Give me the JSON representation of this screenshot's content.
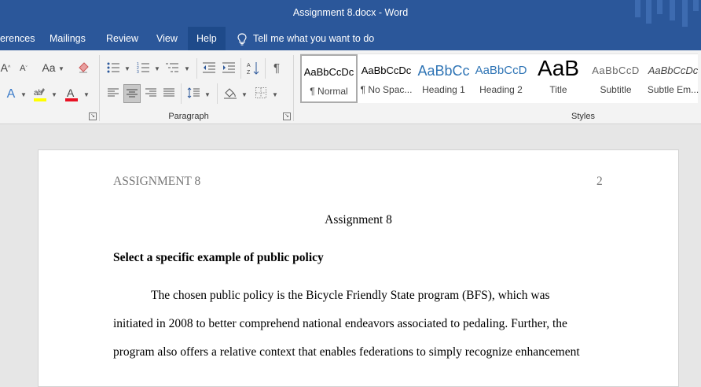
{
  "window": {
    "title": "Assignment 8.docx  -  Word"
  },
  "tabs": {
    "references": "erences",
    "mailings": "Mailings",
    "review": "Review",
    "view": "View",
    "help": "Help"
  },
  "tell_me": "Tell me what you want to do",
  "ribbon": {
    "font_size_label": "Aa",
    "groups": {
      "paragraph": "Paragraph",
      "styles": "Styles"
    },
    "styles": [
      {
        "sample": "AaBbCcDc",
        "name": "¶ Normal"
      },
      {
        "sample": "AaBbCcDc",
        "name": "¶ No Spac..."
      },
      {
        "sample": "AaBbCc",
        "name": "Heading 1"
      },
      {
        "sample": "AaBbCcD",
        "name": "Heading 2"
      },
      {
        "sample": "AaB",
        "name": "Title"
      },
      {
        "sample": "AaBbCcD",
        "name": "Subtitle"
      },
      {
        "sample": "AaBbCcDc",
        "name": "Subtle Em..."
      }
    ]
  },
  "colors": {
    "title_bar": "#2b579a",
    "highlight": "#ffff00",
    "font_color": "#e81123",
    "heading_blue": "#2e74b5"
  },
  "icons": [
    "lightbulb-icon",
    "bullets-icon",
    "numbering-icon",
    "multilevel-list-icon",
    "decrease-indent-icon",
    "increase-indent-icon",
    "sort-icon",
    "show-formatting-icon",
    "align-left-icon",
    "align-center-icon",
    "align-right-icon",
    "justify-icon",
    "line-spacing-icon",
    "shading-icon",
    "borders-icon",
    "text-effects-icon",
    "highlight-icon",
    "font-color-icon",
    "clear-formatting-icon"
  ],
  "document": {
    "header_left": "ASSIGNMENT 8",
    "header_right": "2",
    "title": "Assignment 8",
    "heading": "Select a specific example of public policy",
    "lines": [
      "The chosen public policy is the Bicycle Friendly State program (BFS), which was",
      "initiated in 2008 to better comprehend national endeavors associated to pedaling. Further, the",
      "program also offers a relative context that enables federations to simply recognize enhancement"
    ]
  }
}
